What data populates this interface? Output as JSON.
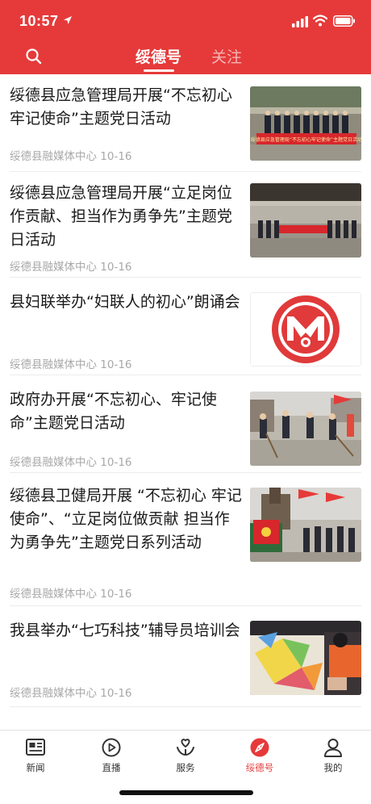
{
  "status_bar": {
    "time": "10:57"
  },
  "header": {
    "tabs": [
      {
        "label": "绥德号",
        "active": true
      },
      {
        "label": "关注",
        "active": false
      }
    ]
  },
  "articles": [
    {
      "title": "绥德县应急管理局开展“不忘初心牢记使命”主题党日活动",
      "source": "绥德县融媒体中心",
      "date": "10-16",
      "banner": "绥德县应急管理局“不忘初心牢记使命”主题党日活动"
    },
    {
      "title": "绥德县应急管理局开展“立足岗位作贡献、担当作为勇争先”主题党日活动",
      "source": "绥德县融媒体中心",
      "date": "10-16",
      "banner": ""
    },
    {
      "title": "县妇联举办“妇联人的初心”朗诵会",
      "source": "绥德县融媒体中心",
      "date": "10-16",
      "banner": ""
    },
    {
      "title": "政府办开展“不忘初心、牢记使命”主题党日活动",
      "source": "绥德县融媒体中心",
      "date": "10-16",
      "banner": ""
    },
    {
      "title": "绥德县卫健局开展 “不忘初心 牢记使命”、“立足岗位做贡献 担当作为勇争先”主题党日系列活动",
      "source": "绥德县融媒体中心",
      "date": "10-16",
      "banner": ""
    },
    {
      "title": "我县举办“七巧科技”辅导员培训会",
      "source": "绥德县融媒体中心",
      "date": "10-16",
      "banner": ""
    }
  ],
  "tabbar": {
    "items": [
      {
        "label": "新闻",
        "icon": "news-icon",
        "active": false
      },
      {
        "label": "直播",
        "icon": "live-play-icon",
        "active": false
      },
      {
        "label": "服务",
        "icon": "service-icon",
        "active": false
      },
      {
        "label": "绥德号",
        "icon": "compass-icon",
        "active": true
      },
      {
        "label": "我的",
        "icon": "user-icon",
        "active": false
      }
    ]
  },
  "colors": {
    "brand_red": "#e63a3a",
    "text": "#1a1a1a",
    "meta_gray": "#a8a8a8"
  }
}
